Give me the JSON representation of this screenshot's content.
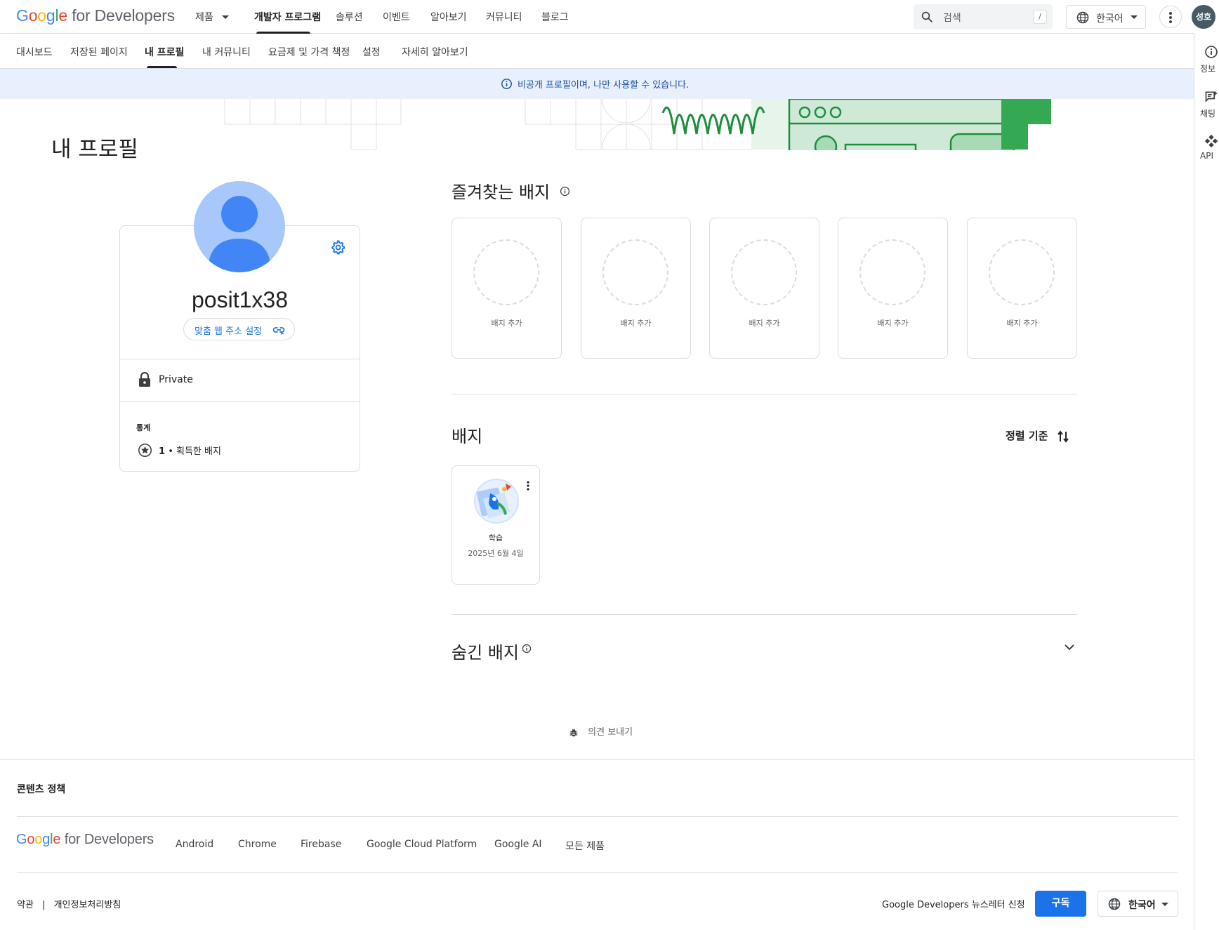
{
  "header": {
    "logo": {
      "g": "G",
      "o1": "o",
      "o2": "o",
      "g2": "g",
      "l": "l",
      "e": "e",
      "rest": " for Developers"
    },
    "nav": [
      {
        "label": "제품",
        "has_dropdown": true
      },
      {
        "label": "개발자 프로그램",
        "active": true
      },
      {
        "label": "솔루션"
      },
      {
        "label": "이벤트"
      },
      {
        "label": "알아보기"
      },
      {
        "label": "커뮤니티"
      },
      {
        "label": "블로그"
      }
    ],
    "search": {
      "placeholder": "검색",
      "shortcut": "/"
    },
    "language": "한국어",
    "avatar_initials": "성호"
  },
  "subnav": [
    {
      "label": "대시보드"
    },
    {
      "label": "저장된 페이지"
    },
    {
      "label": "내 프로필",
      "active": true
    },
    {
      "label": "내 커뮤니티"
    },
    {
      "label": "요금제 및 가격 책정"
    },
    {
      "label": "설정"
    },
    {
      "label": "자세히 알아보기"
    }
  ],
  "rail": [
    {
      "label": "정보",
      "icon": "info-icon"
    },
    {
      "label": "채팅",
      "icon": "chat-icon"
    },
    {
      "label": "API",
      "icon": "api-icon"
    }
  ],
  "banner": {
    "text": "비공개 프로필이며, 나만 사용할 수 있습니다.",
    "icon": "info-icon"
  },
  "page": {
    "title": "내 프로필",
    "profile": {
      "username": "posit1x38",
      "custom_url_label": "맞춤 웹 주소 설정",
      "privacy": "Private",
      "stats_heading": "통계",
      "stats": {
        "count": "1",
        "separator": "•",
        "label": "획득한 배지"
      }
    },
    "favorite_badges": {
      "title": "즐겨찾는 배지",
      "slots": [
        "배지 추가",
        "배지 추가",
        "배지 추가",
        "배지 추가",
        "배지 추가"
      ]
    },
    "badges": {
      "title": "배지",
      "sort_label": "정렬 기준",
      "items": [
        {
          "name": "학습",
          "date": "2025년 6월 4일"
        }
      ]
    },
    "hidden_badges": {
      "title": "숨긴 배지"
    },
    "feedback": "의견 보내기"
  },
  "footer": {
    "content_policy": "콘텐츠 정책",
    "logo_rest": " for Developers",
    "links": [
      "Android",
      "Chrome",
      "Firebase",
      "Google Cloud Platform",
      "Google AI",
      "모든 제품"
    ],
    "legal": [
      "약관",
      "|",
      "개인정보처리방침"
    ],
    "newsletter": "Google Developers 뉴스레터 신청",
    "subscribe": "구독",
    "language": "한국어"
  },
  "colors": {
    "accent": "#1a73e8",
    "banner_bg": "#e8f0fe",
    "avatar_bg": "#a8c7fa",
    "deco_green": "#34a853"
  }
}
